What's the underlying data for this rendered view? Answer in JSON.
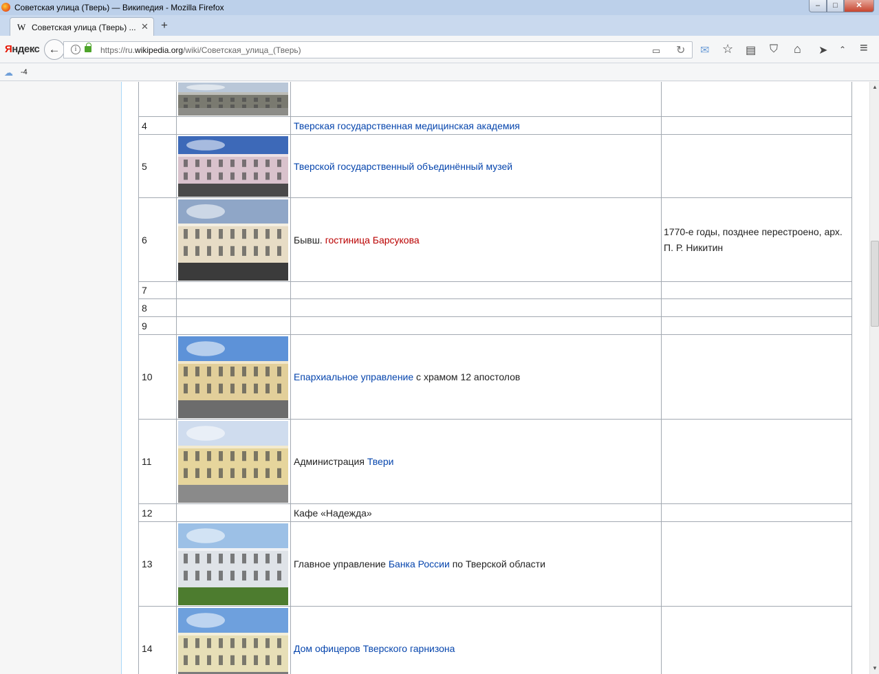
{
  "window": {
    "title": "Советская улица (Тверь) — Википедия - Mozilla Firefox",
    "minimize": "‒",
    "maximize": "□",
    "close": "✕"
  },
  "tab": {
    "favicon": "W",
    "title": "Советская улица (Тверь) ...",
    "close": "✕",
    "new_tab": "+"
  },
  "nav": {
    "yandex_prefix": "Я",
    "yandex_rest": "ндекс",
    "back": "←",
    "url_prefix": "https://ru.",
    "url_domain": "wikipedia.org",
    "url_path": "/wiki/Советская_улица_(Тверь)",
    "info": "i",
    "reader_icon": "▭",
    "reload_icon": "↻",
    "icons": {
      "mail": "✉",
      "star": "☆",
      "library": "▤",
      "pocket": "⛉",
      "home": "⌂",
      "send": "➤",
      "up": "⌃",
      "menu": "≡"
    }
  },
  "weather": {
    "icon": "☁",
    "temp": "-4"
  },
  "table": {
    "rows": [
      {
        "num": "",
        "has_image": true,
        "name": [],
        "notes": ""
      },
      {
        "num": "4",
        "has_image": false,
        "name": [
          {
            "t": "Тверская государственная медицинская академия",
            "s": "link"
          }
        ],
        "notes": ""
      },
      {
        "num": "5",
        "has_image": true,
        "name": [
          {
            "t": "Тверской государственный объединённый музей",
            "s": "link"
          }
        ],
        "notes": ""
      },
      {
        "num": "6",
        "has_image": true,
        "name": [
          {
            "t": "Бывш. ",
            "s": ""
          },
          {
            "t": "гостиница Барсукова",
            "s": "red"
          }
        ],
        "notes": "1770-е годы, позднее перестроено, арх. П. Р. Никитин"
      },
      {
        "num": "7",
        "has_image": false,
        "name": [],
        "notes": ""
      },
      {
        "num": "8",
        "has_image": false,
        "name": [],
        "notes": ""
      },
      {
        "num": "9",
        "has_image": false,
        "name": [],
        "notes": ""
      },
      {
        "num": "10",
        "has_image": true,
        "name": [
          {
            "t": "Епархиальное управление",
            "s": "link"
          },
          {
            "t": " с храмом 12 апостолов",
            "s": ""
          }
        ],
        "notes": ""
      },
      {
        "num": "11",
        "has_image": true,
        "name": [
          {
            "t": "Администрация ",
            "s": ""
          },
          {
            "t": "Твери",
            "s": "link"
          }
        ],
        "notes": ""
      },
      {
        "num": "12",
        "has_image": false,
        "name": [
          {
            "t": "Кафе «Надежда»",
            "s": ""
          }
        ],
        "notes": ""
      },
      {
        "num": "13",
        "has_image": true,
        "name": [
          {
            "t": "Главное управление ",
            "s": ""
          },
          {
            "t": "Банка России",
            "s": "link"
          },
          {
            "t": " по Тверской области",
            "s": ""
          }
        ],
        "notes": ""
      },
      {
        "num": "14",
        "has_image": true,
        "name": [
          {
            "t": "Дом офицеров Тверского гарнизона",
            "s": "link"
          }
        ],
        "notes": ""
      }
    ]
  }
}
